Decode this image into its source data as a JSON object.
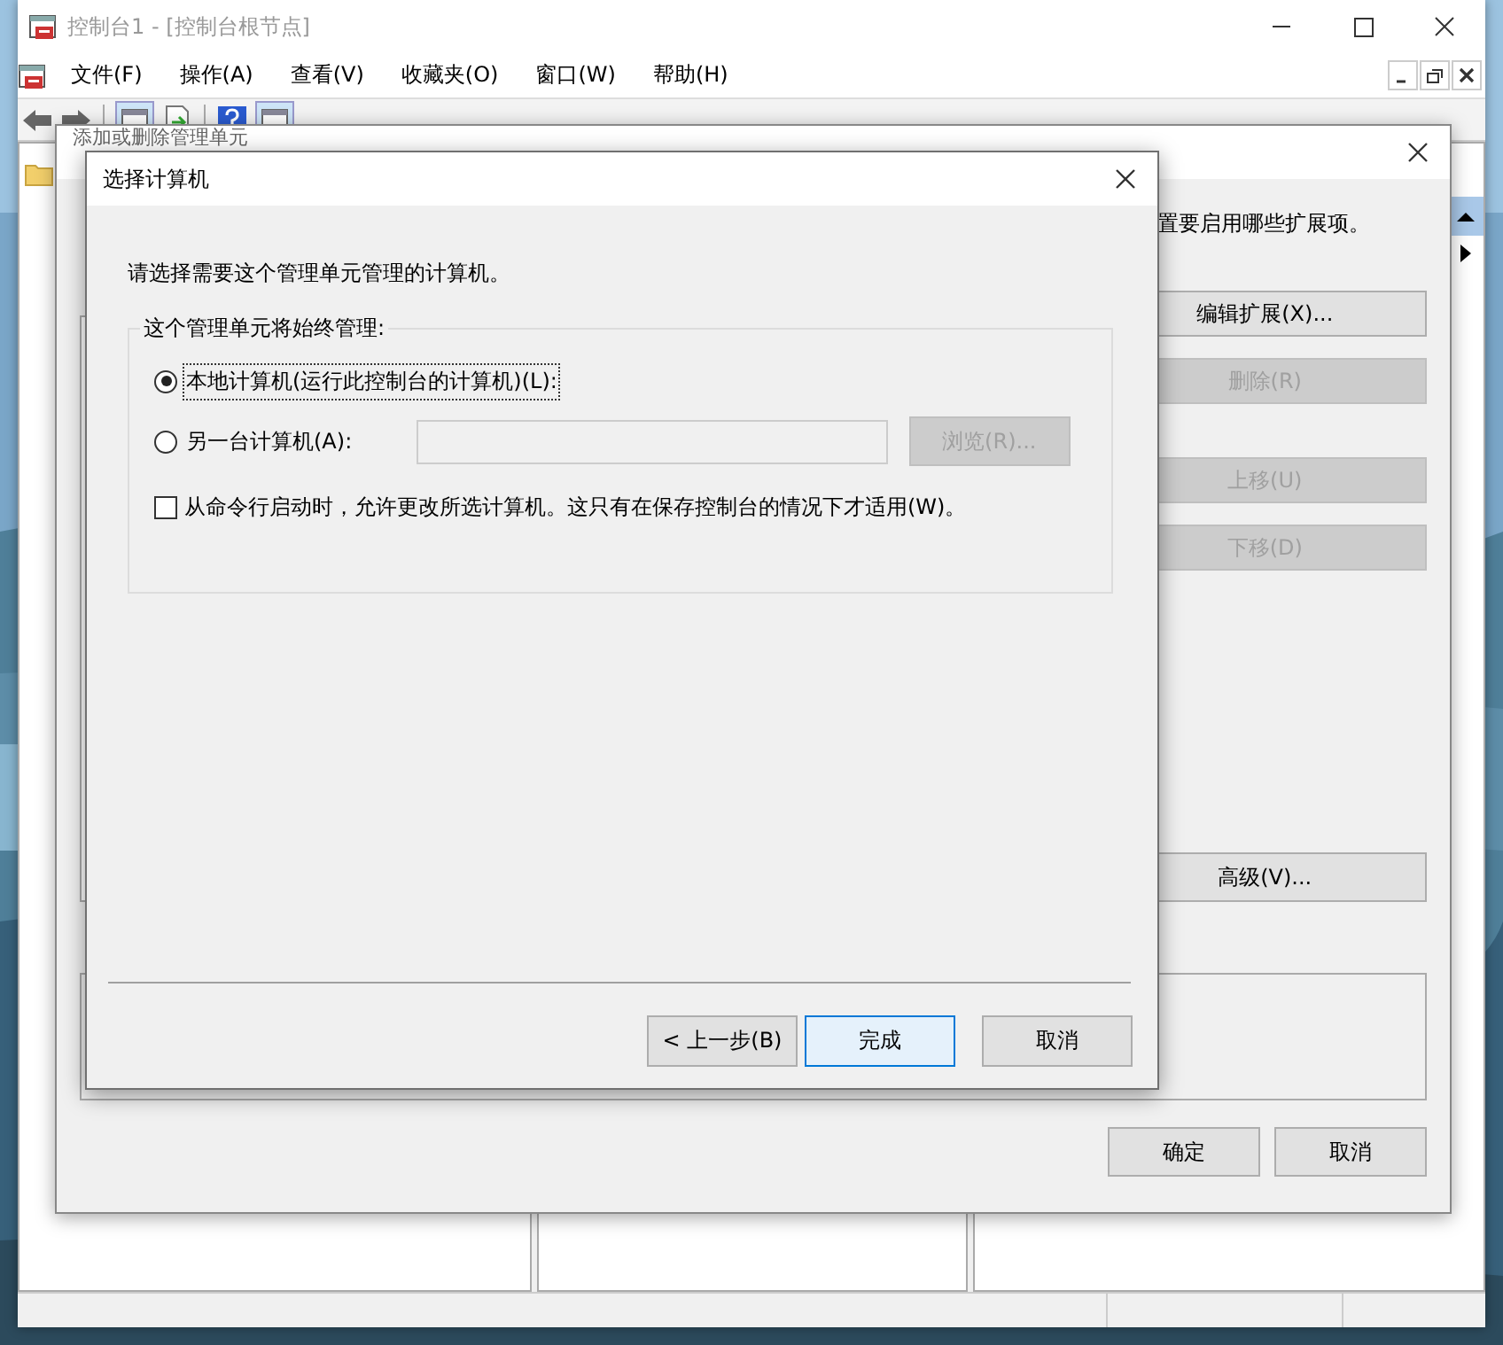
{
  "main_window": {
    "title": "控制台1 - [控制台根节点]",
    "menu": [
      {
        "label": "文件(F)"
      },
      {
        "label": "操作(A)"
      },
      {
        "label": "查看(V)"
      },
      {
        "label": "收藏夹(O)"
      },
      {
        "label": "窗口(W)"
      },
      {
        "label": "帮助(H)"
      }
    ]
  },
  "snapin_dialog": {
    "title": "添加或删除管理单元",
    "description": "置要启用哪些扩展项。",
    "side_buttons": [
      {
        "label": "编辑扩展(X)...",
        "disabled": false
      },
      {
        "label": "删除(R)",
        "disabled": true
      },
      {
        "label": "上移(U)",
        "disabled": true
      },
      {
        "label": "下移(D)",
        "disabled": true
      }
    ],
    "advanced_button": {
      "label": "高级(V)...",
      "disabled": false
    },
    "buttons": [
      {
        "label": "确定"
      },
      {
        "label": "取消"
      }
    ]
  },
  "computer_dialog": {
    "title": "选择计算机",
    "prompt": "请选择需要这个管理单元管理的计算机。",
    "group_label": "这个管理单元将始终管理:",
    "options": [
      {
        "label": "本地计算机(运行此控制台的计算机)(L):",
        "selected": true,
        "focused": true
      },
      {
        "label": "另一台计算机(A):",
        "selected": false,
        "focused": false
      }
    ],
    "computer_field": {
      "disabled": true
    },
    "browse_button": {
      "label": "浏览(R)...",
      "disabled": true
    },
    "allow_change": {
      "label": "从命令行启动时，允许更改所选计算机。这只有在保存控制台的情况下才适用(W)。",
      "checked": false
    },
    "buttons": [
      {
        "label": "< 上一步(B)",
        "default": false
      },
      {
        "label": "完成",
        "default": true
      },
      {
        "label": "取消",
        "default": false
      }
    ]
  }
}
